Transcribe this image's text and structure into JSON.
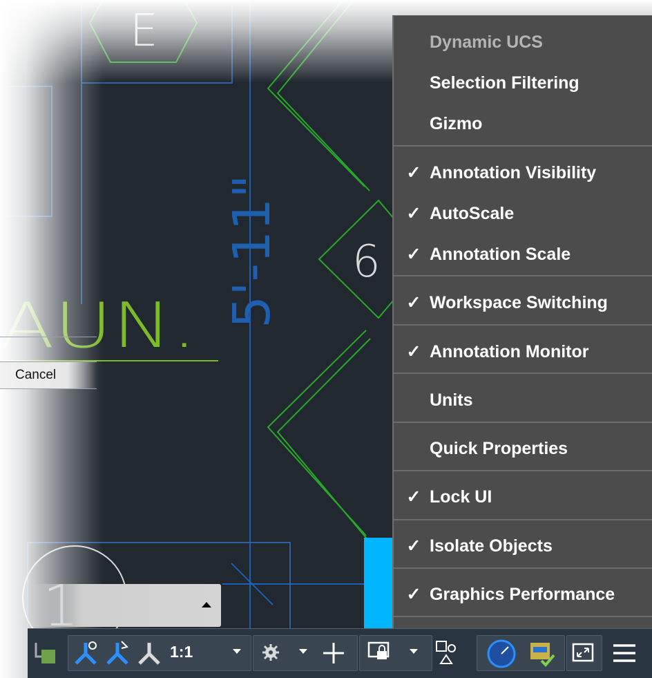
{
  "drawing": {
    "dimension_text": "5'-11\"",
    "hexagon_tag": "E",
    "diamond_tag": "6",
    "room_label": "AUN.",
    "circle_tag": "11"
  },
  "dialog": {
    "cancel_label": "Cancel"
  },
  "context_menu": {
    "items": [
      {
        "label": "Dynamic UCS",
        "checked": false,
        "enabled": false
      },
      {
        "label": "Selection Filtering",
        "checked": false,
        "enabled": true
      },
      {
        "label": "Gizmo",
        "checked": false,
        "enabled": true
      },
      {
        "label": "Annotation Visibility",
        "checked": true,
        "enabled": true
      },
      {
        "label": "AutoScale",
        "checked": true,
        "enabled": true
      },
      {
        "label": "Annotation Scale",
        "checked": true,
        "enabled": true
      },
      {
        "label": "Workspace Switching",
        "checked": true,
        "enabled": true
      },
      {
        "label": "Annotation Monitor",
        "checked": true,
        "enabled": true
      },
      {
        "label": "Units",
        "checked": false,
        "enabled": true
      },
      {
        "label": "Quick Properties",
        "checked": false,
        "enabled": true
      },
      {
        "label": "Lock UI",
        "checked": true,
        "enabled": true
      },
      {
        "label": "Isolate Objects",
        "checked": true,
        "enabled": true
      },
      {
        "label": "Graphics Performance",
        "checked": true,
        "enabled": true
      }
    ],
    "check_glyph": "✓"
  },
  "statusbar": {
    "annotation_scale": "1:1"
  },
  "colors": {
    "canvas_bg": "#212830",
    "drawing_green": "#2aa82a",
    "dimension_blue": "#1f5fb0",
    "menu_bg": "#4c4c4c",
    "statusbar_bg": "#2a3542",
    "highlight_cyan": "#00b7ff",
    "active_icon_blue": "#2b8fff"
  }
}
